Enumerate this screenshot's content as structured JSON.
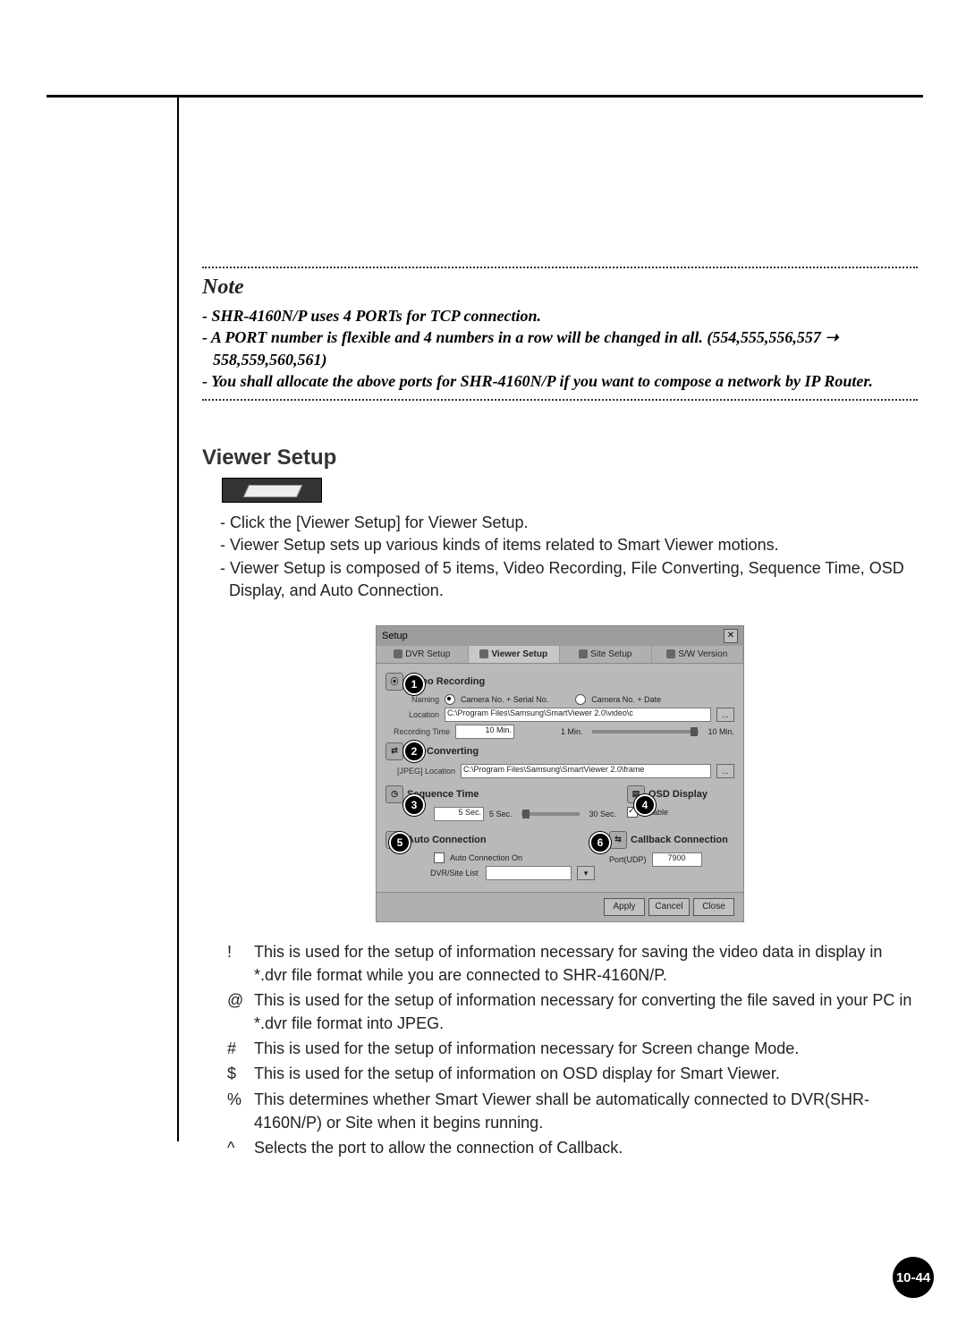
{
  "note": {
    "title": "Note",
    "items": [
      "SHR-4160N/P uses 4 PORTs for TCP connection.",
      "A PORT number is flexible and 4 numbers in a row will be changed in all. (554,555,556,557 ➝ 558,559,560,561)",
      "You shall allocate the above ports for SHR-4160N/P if you want to compose a network by IP Router."
    ]
  },
  "section_heading": "Viewer Setup",
  "intro_items": [
    "Click the [Viewer Setup] for Viewer Setup.",
    "Viewer Setup sets up various kinds of items related to Smart Viewer motions.",
    "Viewer Setup is composed of 5 items, Video Recording, File Converting, Sequence Time, OSD Display, and Auto Connection."
  ],
  "dialog": {
    "title": "Setup",
    "tabs": [
      "DVR Setup",
      "Viewer Setup",
      "Site Setup",
      "S/W Version"
    ],
    "active_tab": 1,
    "video_recording": {
      "heading": "Video Recording",
      "naming_label": "Naming",
      "naming_opt1": "Camera No. + Serial No.",
      "naming_opt2": "Camera No. + Date",
      "location_label": "Location",
      "location_value": "C:\\Program Files\\Samsung\\SmartViewer 2.0\\video\\c",
      "rectime_label": "Recording Time",
      "rectime_value": "10  Min.",
      "rectime_min": "1 Min.",
      "rectime_max": "10 Min."
    },
    "file_converting": {
      "heading": "File Converting",
      "loc_label": "[JPEG]  Location",
      "loc_value": "C:\\Program Files\\Samsung\\SmartViewer 2.0\\frame"
    },
    "sequence_time": {
      "heading": "Sequence Time",
      "value": "5  Sec.",
      "min": "5 Sec.",
      "max": "30 Sec."
    },
    "osd_display": {
      "heading": "OSD Display",
      "enable_label": "Enable"
    },
    "auto_connection": {
      "heading": "Auto Connection",
      "chk_label": "Auto Connection On",
      "list_label": "DVR/Site List"
    },
    "callback_connection": {
      "heading": "Callback Connection",
      "port_label": "Port(UDP)",
      "port_value": "7900"
    },
    "buttons": {
      "apply": "Apply",
      "cancel": "Cancel",
      "close": "Close"
    }
  },
  "callouts": [
    "1",
    "2",
    "3",
    "4",
    "5",
    "6"
  ],
  "explanations": [
    {
      "sym": "!",
      "text": "This is used for the setup of information necessary for saving the video data in display in *.dvr file format while you are connected to SHR-4160N/P."
    },
    {
      "sym": "@",
      "text": "This is used for the setup of information necessary for converting the file saved in your PC in *.dvr file format into JPEG."
    },
    {
      "sym": "#",
      "text": "This is used for the setup of information necessary for Screen change Mode."
    },
    {
      "sym": "$",
      "text": "This is used for the setup of information on OSD display for Smart Viewer."
    },
    {
      "sym": "%",
      "text": "This determines whether Smart Viewer shall be automatically connected to DVR(SHR-4160N/P) or Site when it begins running."
    },
    {
      "sym": "^",
      "text": "Selects the port to allow the connection of Callback."
    }
  ],
  "page_number": "10-44"
}
